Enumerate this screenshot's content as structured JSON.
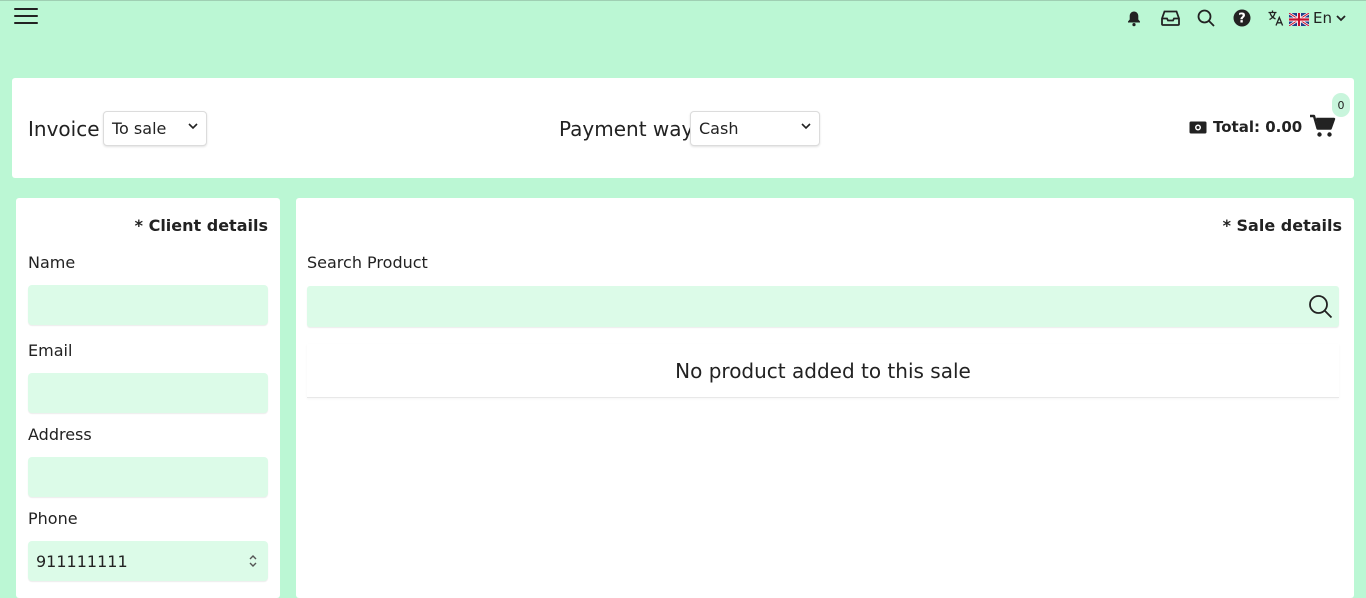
{
  "topbar": {
    "language_label": "En"
  },
  "header": {
    "invoice_label": "Invoice",
    "invoice_type_value": "To sale",
    "payment_label": "Payment way",
    "payment_value": "Cash",
    "total_label": "Total: 0.00",
    "cart_count": "0"
  },
  "client": {
    "title": "* Client details",
    "name_label": "Name",
    "name_value": "",
    "email_label": "Email",
    "email_value": "",
    "address_label": "Address",
    "address_value": "",
    "phone_label": "Phone",
    "phone_value": "911111111"
  },
  "sale": {
    "title": "* Sale details",
    "search_label": "Search Product",
    "search_value": "",
    "empty_message": "No product added to this sale"
  },
  "colors": {
    "page_background": "#bbf7d4",
    "input_background": "#dcfbe8"
  }
}
